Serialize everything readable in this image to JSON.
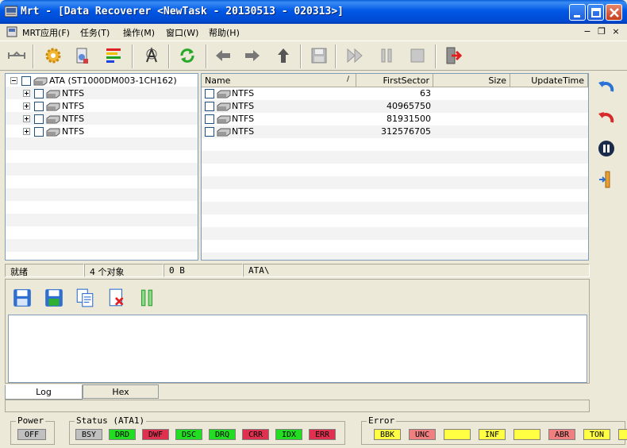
{
  "window": {
    "title": "Mrt - [Data Recoverer <NewTask - 20130513 - 020313>]",
    "minimize_glyph": "_",
    "maximize_glyph": "□",
    "close_glyph": "×"
  },
  "menu": {
    "items": [
      {
        "label": "MRT应用(F)"
      },
      {
        "label": "任务(T)"
      },
      {
        "label": "操作(M)"
      },
      {
        "label": "窗口(W)"
      },
      {
        "label": "帮助(H)"
      }
    ],
    "mdi_min": "−",
    "mdi_restore": "❐",
    "mdi_close": "×"
  },
  "tree": {
    "root": {
      "label": "ATA (ST1000DM003-1CH162)"
    },
    "children": [
      {
        "label": "NTFS"
      },
      {
        "label": "NTFS"
      },
      {
        "label": "NTFS"
      },
      {
        "label": "NTFS"
      }
    ]
  },
  "list": {
    "columns": [
      {
        "label": "Name"
      },
      {
        "label": "FirstSector"
      },
      {
        "label": "Size"
      },
      {
        "label": "UpdateTime"
      }
    ],
    "sort_glyph": "/",
    "rows": [
      {
        "name": "NTFS",
        "first_sector": "63",
        "size": "",
        "update_time": ""
      },
      {
        "name": "NTFS",
        "first_sector": "40965750",
        "size": "",
        "update_time": ""
      },
      {
        "name": "NTFS",
        "first_sector": "81931500",
        "size": "",
        "update_time": ""
      },
      {
        "name": "NTFS",
        "first_sector": "312576705",
        "size": "",
        "update_time": ""
      }
    ]
  },
  "status": {
    "ready": "就绪",
    "objects": "4 个对象",
    "bytes": "0 B",
    "path": "ATA\\"
  },
  "log": {
    "tabs": [
      {
        "label": "Log"
      },
      {
        "label": "Hex"
      }
    ]
  },
  "leds": {
    "power_title": "Power",
    "power": [
      {
        "label": "OFF",
        "color": "#c0c0c0"
      }
    ],
    "status_title": "Status (ATA1)",
    "status": [
      {
        "label": "BSY",
        "color": "#c0c0c0"
      },
      {
        "label": "DRD",
        "color": "#22dd22"
      },
      {
        "label": "DWF",
        "color": "#e03050"
      },
      {
        "label": "DSC",
        "color": "#22dd22"
      },
      {
        "label": "DRQ",
        "color": "#22dd22"
      },
      {
        "label": "CRR",
        "color": "#e03050"
      },
      {
        "label": "IDX",
        "color": "#22dd22"
      },
      {
        "label": "ERR",
        "color": "#e03050"
      }
    ],
    "error_title": "Error",
    "error": [
      {
        "label": "BBK",
        "color": "#ffff44"
      },
      {
        "label": "UNC",
        "color": "#f08080"
      },
      {
        "label": "",
        "color": "#ffff44"
      },
      {
        "label": "INF",
        "color": "#ffff44"
      },
      {
        "label": "",
        "color": "#ffff44"
      },
      {
        "label": "ABR",
        "color": "#f08080"
      },
      {
        "label": "TON",
        "color": "#ffff44"
      },
      {
        "label": "",
        "color": "#ffff44"
      }
    ]
  }
}
